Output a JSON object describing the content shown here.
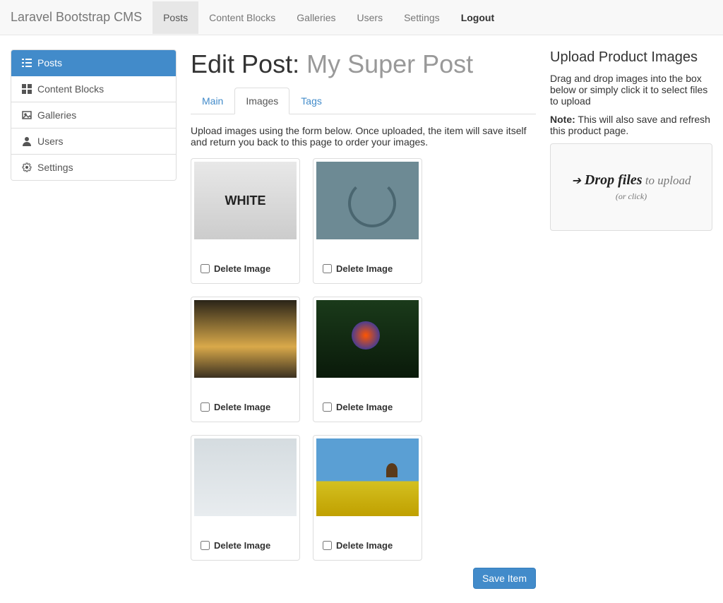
{
  "brand": "Laravel Bootstrap CMS",
  "nav": {
    "posts": "Posts",
    "content_blocks": "Content Blocks",
    "galleries": "Galleries",
    "users": "Users",
    "settings": "Settings",
    "logout": "Logout"
  },
  "sidebar": {
    "posts": "Posts",
    "content_blocks": "Content Blocks",
    "galleries": "Galleries",
    "users": "Users",
    "settings": "Settings"
  },
  "page": {
    "title_prefix": "Edit Post: ",
    "title_name": "My Super Post",
    "tabs": {
      "main": "Main",
      "images": "Images",
      "tags": "Tags"
    },
    "help_text": "Upload images using the form below. Once uploaded, the item will save itself and return you back to this page to order your images.",
    "delete_label": "Delete Image",
    "save_button": "Save Item",
    "thumb_white": "WHITE"
  },
  "upload": {
    "heading": "Upload Product Images",
    "desc": "Drag and drop images into the box below or simply click it to select files to upload",
    "note_label": "Note:",
    "note_text": " This will also save and refresh this product page.",
    "drop_strong": "Drop files",
    "drop_light": " to upload",
    "drop_sub": "(or click)"
  }
}
